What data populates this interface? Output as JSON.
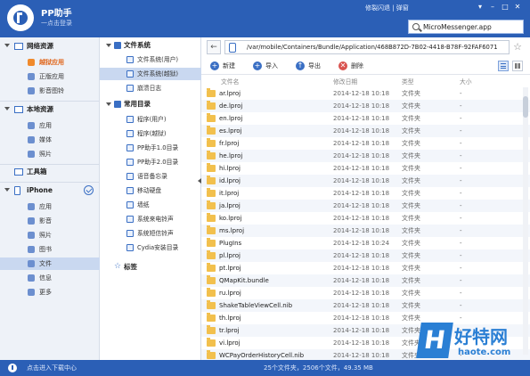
{
  "window": {
    "app_title": "PP助手",
    "app_subtitle": "一点击登录",
    "top_links": "修裂闪退 | 弹窗",
    "window_buttons": [
      "▾",
      "–",
      "□",
      "✕"
    ]
  },
  "search": {
    "value": "MicroMessenger.app"
  },
  "sidebar": {
    "sections": [
      {
        "label": "网络资源",
        "items": [
          "越狱应用",
          "正版应用",
          "影音图铃"
        ]
      },
      {
        "label": "本地资源",
        "items": [
          "应用",
          "媒体",
          "照片"
        ]
      },
      {
        "label": "工具箱",
        "items": []
      },
      {
        "label": "iPhone",
        "items": [
          "应用",
          "影音",
          "照片",
          "图书",
          "文件",
          "信息",
          "更多"
        ]
      }
    ]
  },
  "tree": {
    "groups": [
      {
        "label": "文件系统",
        "items": [
          "文件系统(用户)",
          "文件系统(越狱)",
          "崩溃日志"
        ]
      },
      {
        "label": "常用目录",
        "items": [
          "程序(用户)",
          "程序(越狱)",
          "PP助手1.0目录",
          "PP助手2.0目录",
          "语音备忘录",
          "移动硬盘",
          "墙纸",
          "系统来电铃声",
          "系统短信铃声",
          "Cydia安装目录"
        ]
      },
      {
        "label": "标签",
        "items": []
      }
    ]
  },
  "address": {
    "back": "←",
    "path": "/var/mobile/Containers/Bundle/Application/468B872D-7B02-4418-B78F-92FAF6071",
    "fav": "☆"
  },
  "toolbar": {
    "new": "新建",
    "import": "导入",
    "export": "导出",
    "delete": "删除",
    "new_icon": "+",
    "import_icon": "+",
    "export_icon": "↑",
    "delete_icon": "✕"
  },
  "table": {
    "headers": {
      "name": "文件名",
      "date": "修改日期",
      "type": "类型",
      "size": "大小"
    },
    "rows": [
      {
        "name": "ar.lproj",
        "date": "2014-12-18 10:18",
        "type": "文件夹",
        "size": "-"
      },
      {
        "name": "de.lproj",
        "date": "2014-12-18 10:18",
        "type": "文件夹",
        "size": "-"
      },
      {
        "name": "en.lproj",
        "date": "2014-12-18 10:18",
        "type": "文件夹",
        "size": "-"
      },
      {
        "name": "es.lproj",
        "date": "2014-12-18 10:18",
        "type": "文件夹",
        "size": "-"
      },
      {
        "name": "fr.lproj",
        "date": "2014-12-18 10:18",
        "type": "文件夹",
        "size": "-"
      },
      {
        "name": "he.lproj",
        "date": "2014-12-18 10:18",
        "type": "文件夹",
        "size": "-"
      },
      {
        "name": "hi.lproj",
        "date": "2014-12-18 10:18",
        "type": "文件夹",
        "size": "-"
      },
      {
        "name": "id.lproj",
        "date": "2014-12-18 10:18",
        "type": "文件夹",
        "size": "-"
      },
      {
        "name": "it.lproj",
        "date": "2014-12-18 10:18",
        "type": "文件夹",
        "size": "-"
      },
      {
        "name": "ja.lproj",
        "date": "2014-12-18 10:18",
        "type": "文件夹",
        "size": "-"
      },
      {
        "name": "ko.lproj",
        "date": "2014-12-18 10:18",
        "type": "文件夹",
        "size": "-"
      },
      {
        "name": "ms.lproj",
        "date": "2014-12-18 10:18",
        "type": "文件夹",
        "size": "-"
      },
      {
        "name": "PlugIns",
        "date": "2014-12-18 10:24",
        "type": "文件夹",
        "size": "-"
      },
      {
        "name": "pl.lproj",
        "date": "2014-12-18 10:18",
        "type": "文件夹",
        "size": "-"
      },
      {
        "name": "pt.lproj",
        "date": "2014-12-18 10:18",
        "type": "文件夹",
        "size": "-"
      },
      {
        "name": "QMapKit.bundle",
        "date": "2014-12-18 10:18",
        "type": "文件夹",
        "size": "-"
      },
      {
        "name": "ru.lproj",
        "date": "2014-12-18 10:18",
        "type": "文件夹",
        "size": "-"
      },
      {
        "name": "ShakeTableViewCell.nib",
        "date": "2014-12-18 10:18",
        "type": "文件夹",
        "size": "-"
      },
      {
        "name": "th.lproj",
        "date": "2014-12-18 10:18",
        "type": "文件夹",
        "size": "-"
      },
      {
        "name": "tr.lproj",
        "date": "2014-12-18 10:18",
        "type": "文件夹",
        "size": "-"
      },
      {
        "name": "vi.lproj",
        "date": "2014-12-18 10:18",
        "type": "文件夹",
        "size": "-"
      },
      {
        "name": "WCPayOrderHistoryCell.nib",
        "date": "2014-12-18 10:18",
        "type": "文件夹",
        "size": "-"
      }
    ]
  },
  "status": {
    "download_center": "点击进入下载中心",
    "summary": "25个文件夹，2506个文件，49.35 MB"
  },
  "watermark": {
    "glyph": "H",
    "text": "好特网",
    "url": "haote.com"
  }
}
